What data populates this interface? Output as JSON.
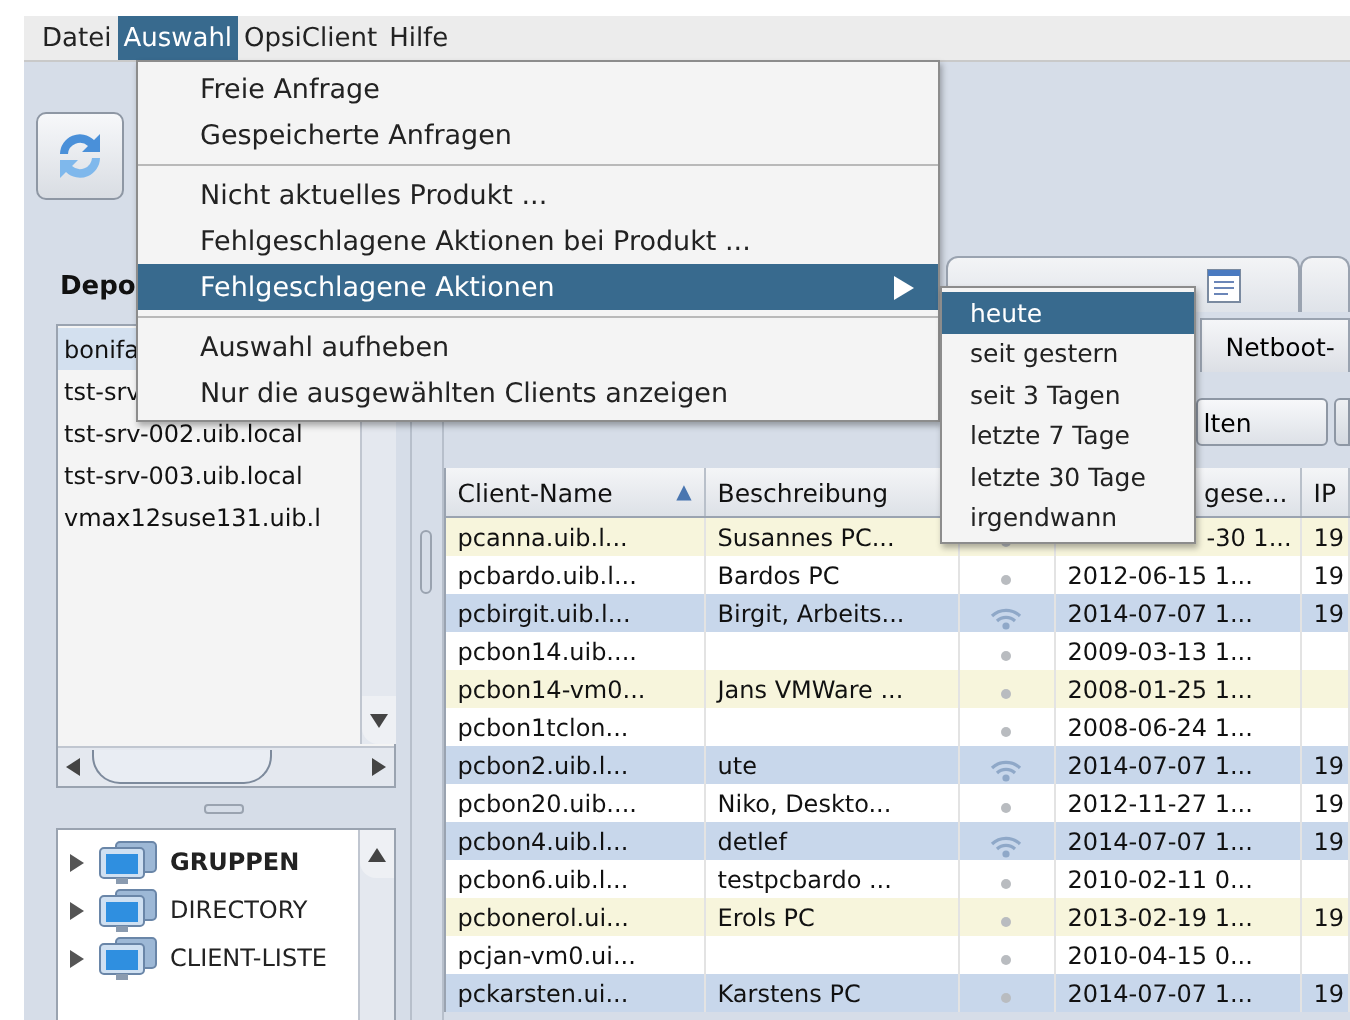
{
  "menubar": [
    {
      "label": "Datei",
      "selected": false
    },
    {
      "label": "Auswahl",
      "selected": true
    },
    {
      "label": "OpsiClient",
      "selected": false
    },
    {
      "label": "Hilfe",
      "selected": false
    }
  ],
  "menu": {
    "groups": [
      [
        {
          "label": "Freie Anfrage",
          "selected": false,
          "submenu": false
        },
        {
          "label": "Gespeicherte Anfragen",
          "selected": false,
          "submenu": false
        }
      ],
      [
        {
          "label": "Nicht aktuelles Produkt ...",
          "selected": false,
          "submenu": false
        },
        {
          "label": "Fehlgeschlagene Aktionen bei Produkt ...",
          "selected": false,
          "submenu": false
        },
        {
          "label": "Fehlgeschlagene Aktionen",
          "selected": true,
          "submenu": true
        }
      ],
      [
        {
          "label": "Auswahl aufheben",
          "selected": false,
          "submenu": false
        },
        {
          "label": "Nur die ausgewählten Clients anzeigen",
          "selected": false,
          "submenu": false
        }
      ]
    ]
  },
  "submenu": {
    "items": [
      {
        "label": "heute",
        "selected": true
      },
      {
        "label": "seit gestern",
        "selected": false
      },
      {
        "label": "seit 3 Tagen",
        "selected": false
      },
      {
        "label": "letzte 7 Tage",
        "selected": false
      },
      {
        "label": "letzte 30 Tage",
        "selected": false
      },
      {
        "label": "irgendwann",
        "selected": false
      }
    ]
  },
  "depots": {
    "title": "Depo",
    "items": [
      {
        "label": "bonifa",
        "selected": true
      },
      {
        "label": "tst-srv",
        "selected": false
      },
      {
        "label": "tst-srv-002.uib.local",
        "selected": false
      },
      {
        "label": "tst-srv-003.uib.local",
        "selected": false
      },
      {
        "label": "vmax12suse131.uib.l",
        "selected": false
      }
    ]
  },
  "tree": [
    {
      "label": "GRUPPEN",
      "expanded": false,
      "bold": true
    },
    {
      "label": "DIRECTORY",
      "expanded": false,
      "bold": false
    },
    {
      "label": "CLIENT-LISTE",
      "expanded": false,
      "bold": false
    }
  ],
  "tabs": [
    {
      "label": "Netboot-",
      "selected": false
    }
  ],
  "button": {
    "label": "lten"
  },
  "table": {
    "columns": [
      {
        "label": "Client-Name",
        "sort_icon": "▲"
      },
      {
        "label": "Beschreibung"
      },
      {},
      {
        "label": "gese..."
      },
      {
        "label": "IP"
      }
    ],
    "rows": [
      {
        "name": "pcanna.uib.l...",
        "description": "Susannes PC...",
        "connected": false,
        "date": "-30 1...",
        "ip": "19",
        "color": "#f7f5dc"
      },
      {
        "name": "pcbardo.uib.l...",
        "description": "Bardos PC",
        "connected": false,
        "date": "2012-06-15 1...",
        "ip": "19",
        "color": "#ffffff"
      },
      {
        "name": "pcbirgit.uib.l...",
        "description": "Birgit, Arbeits...",
        "connected": true,
        "date": "2014-07-07 1...",
        "ip": "19",
        "color": "#c8d7eb"
      },
      {
        "name": "pcbon14.uib....",
        "connected": false,
        "date": "2009-03-13 1...",
        "color": "#ffffff"
      },
      {
        "name": "pcbon14-vm0...",
        "description": "Jans VMWare ...",
        "connected": false,
        "date": "2008-01-25 1...",
        "color": "#f7f5dc"
      },
      {
        "name": "pcbon1tclon...",
        "connected": false,
        "date": "2008-06-24 1...",
        "color": "#ffffff"
      },
      {
        "name": "pcbon2.uib.l...",
        "description": "ute",
        "connected": true,
        "date": "2014-07-07 1...",
        "ip": "19",
        "color": "#c8d7eb"
      },
      {
        "name": "pcbon20.uib....",
        "description": "Niko, Deskto...",
        "connected": false,
        "date": "2012-11-27 1...",
        "ip": "19",
        "color": "#ffffff"
      },
      {
        "name": "pcbon4.uib.l...",
        "description": "detlef",
        "connected": true,
        "date": "2014-07-07 1...",
        "ip": "19",
        "color": "#c8d7eb"
      },
      {
        "name": "pcbon6.uib.l...",
        "description": "testpcbardo ...",
        "connected": false,
        "date": "2010-02-11 0...",
        "color": "#ffffff"
      },
      {
        "name": "pcbonerol.ui...",
        "description": "Erols PC",
        "connected": false,
        "date": "2013-02-19 1...",
        "ip": "19",
        "color": "#f7f5dc"
      },
      {
        "name": "pcjan-vm0.ui...",
        "connected": false,
        "date": "2010-04-15 0...",
        "color": "#ffffff"
      },
      {
        "name": "pckarsten.ui...",
        "description": "Karstens PC",
        "connected": false,
        "date": "2014-07-07 1...",
        "ip": "19",
        "color": "#c8d7eb"
      }
    ]
  }
}
